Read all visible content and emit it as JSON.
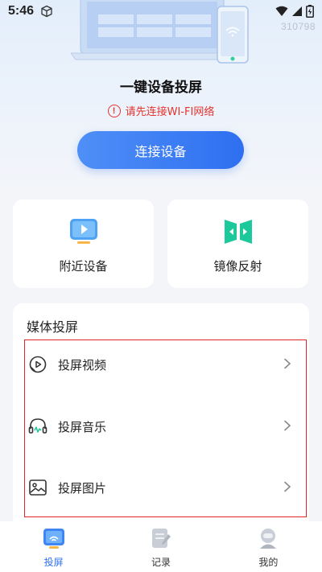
{
  "status_bar": {
    "time": "5:46"
  },
  "watermark": "310798",
  "hero": {
    "title": "一键设备投屏",
    "warning": "请先连接WI-FI网络",
    "connect_button": "连接设备"
  },
  "cards": {
    "nearby": "附近设备",
    "mirror": "镜像反射"
  },
  "media": {
    "title": "媒体投屏",
    "items": [
      {
        "label": "投屏视频",
        "icon": "video-play-icon"
      },
      {
        "label": "投屏音乐",
        "icon": "headphones-icon"
      },
      {
        "label": "投屏图片",
        "icon": "image-icon"
      }
    ]
  },
  "tabs": [
    {
      "label": "投屏",
      "icon": "cast-icon",
      "active": true
    },
    {
      "label": "记录",
      "icon": "history-icon",
      "active": false
    },
    {
      "label": "我的",
      "icon": "profile-icon",
      "active": false
    }
  ],
  "colors": {
    "accent": "#2e6ff1",
    "warning": "#e5332e",
    "mirror_icon": "#1dc99b",
    "highlight_border": "#e0242a"
  }
}
